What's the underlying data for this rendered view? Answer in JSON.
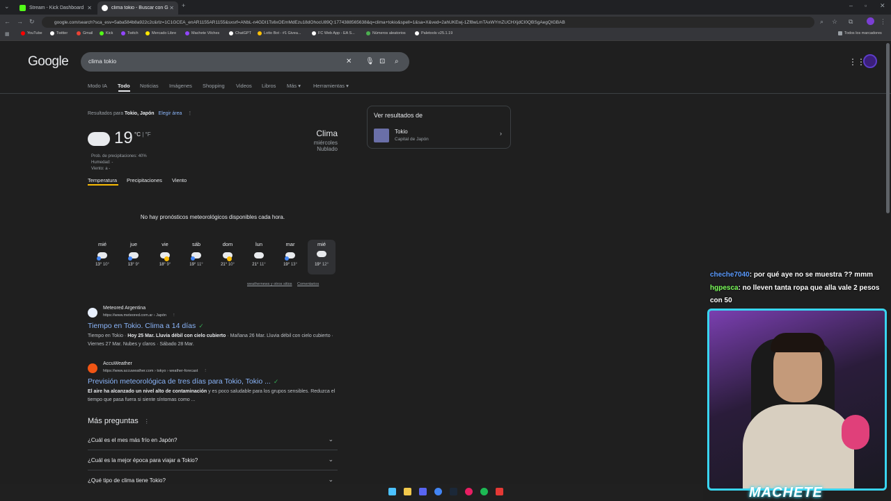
{
  "browser": {
    "tabs": [
      {
        "title": "Stream - Kick Dashboard",
        "active": false
      },
      {
        "title": "clima tokio - Buscar con Google",
        "active": true
      }
    ],
    "url": "google.com/search?sca_esv=5aba584b8a922c2c&rlz=1C1GCEA_enAR1155AR1155&sxsrf=ANbL-n4GDI1Ts6xOEmMdEzu18dOhocU89Q:1774388565638&q=clima+tokio&spell=1&sa=X&ved=2ahUKEwj-1Zf8wLmTAxWYmZUCHXjdCI0QBSgAegQIGBAB",
    "bookmarks": [
      "YouTube",
      "Twitter",
      "Gmail",
      "Kick",
      "Twitch",
      "Mercado Libre",
      "Machete Vilches",
      "ChatGPT",
      "Lotto Bot - #1 Givea...",
      "FC Web App - EA S...",
      "Números aleatorios",
      "Paletools v25.1.19"
    ],
    "all_bookmarks": "Todos los marcadores"
  },
  "google": {
    "logo": "Google",
    "query": "clima tokio",
    "nav_tabs": [
      "Modo IA",
      "Todo",
      "Noticias",
      "Imágenes",
      "Shopping",
      "Videos",
      "Libros",
      "Más ▾",
      "Herramientas ▾"
    ]
  },
  "weather": {
    "results_for_prefix": "Resultados para ",
    "location": "Tokio, Japón",
    "choose_area": "Elegir área",
    "temp": "19",
    "unit_c": "°C",
    "unit_sep": " | ",
    "unit_f": "°F",
    "precip": "Prob. de precipitaciones: 40%",
    "humidity": "Humedad: -",
    "wind": "Viento: a -",
    "title": "Clima",
    "day": "miércoles",
    "condition": "Nublado",
    "tabs": [
      "Temperatura",
      "Precipitaciones",
      "Viento"
    ],
    "no_hourly": "No hay pronósticos meteorológicos disponibles cada hora.",
    "forecast": [
      {
        "day": "mié",
        "high": "13°",
        "low": "10°",
        "icon": "rain-icon"
      },
      {
        "day": "jue",
        "high": "13°",
        "low": "9°",
        "icon": "rain-icon"
      },
      {
        "day": "vie",
        "high": "18°",
        "low": "9°",
        "icon": "partly-sunny-icon"
      },
      {
        "day": "sáb",
        "high": "19°",
        "low": "11°",
        "icon": "rain-icon"
      },
      {
        "day": "dom",
        "high": "21°",
        "low": "10°",
        "icon": "partly-sunny-icon"
      },
      {
        "day": "lun",
        "high": "21°",
        "low": "11°",
        "icon": "cloud-icon"
      },
      {
        "day": "mar",
        "high": "19°",
        "low": "13°",
        "icon": "rain-icon"
      },
      {
        "day": "mié",
        "high": "19°",
        "low": "12°",
        "icon": "cloud-icon"
      }
    ],
    "source": "weathernews y otros sitios",
    "feedback": "Comentarios"
  },
  "side_panel": {
    "heading": "Ver resultados de",
    "entity_name": "Tokio",
    "entity_desc": "Capital de Japón"
  },
  "results": [
    {
      "site": "Meteored Argentina",
      "url": "https://www.meteored.com.ar › Japón",
      "title": "Tiempo en Tokio. Clima a 14 días",
      "snippet_a": "Tiempo en Tokio · ",
      "snippet_b": "Hoy 25 Mar. Lluvia débil con cielo cubierto",
      "snippet_c": " · Mañana 26 Mar. Lluvia débil con cielo cubierto · Viernes 27 Mar. Nubes y claros · Sábado 28 Mar."
    },
    {
      "site": "AccuWeather",
      "url": "https://www.accuweather.com › tokyo › weather-forecast",
      "title": "Previsión meteorológica de tres días para Tokio, Tokio ...",
      "snippet_a": "",
      "snippet_b": "El aire ha alcanzado un nivel alto de contaminación",
      "snippet_c": " y es poco saludable para los grupos sensibles. Reduzca el tiempo que pasa fuera si siente síntomas como ..."
    }
  ],
  "paa": {
    "heading": "Más preguntas",
    "questions": [
      "¿Cuál es el mes más frío en Japón?",
      "¿Cuál es la mejor época para viajar a Tokio?",
      "¿Qué tipo de clima tiene Tokio?"
    ]
  },
  "chat": [
    {
      "user": "cheche7040",
      "text": ": por qué aye no se muestra ?? mmm",
      "color": "#5b9bff"
    },
    {
      "user": "hgpesca",
      "text": ": no lleven tanta ropa que alla vale 2 pesos con 50",
      "color": "#7cff5b"
    }
  ],
  "overlay_brand": "MACHETE"
}
